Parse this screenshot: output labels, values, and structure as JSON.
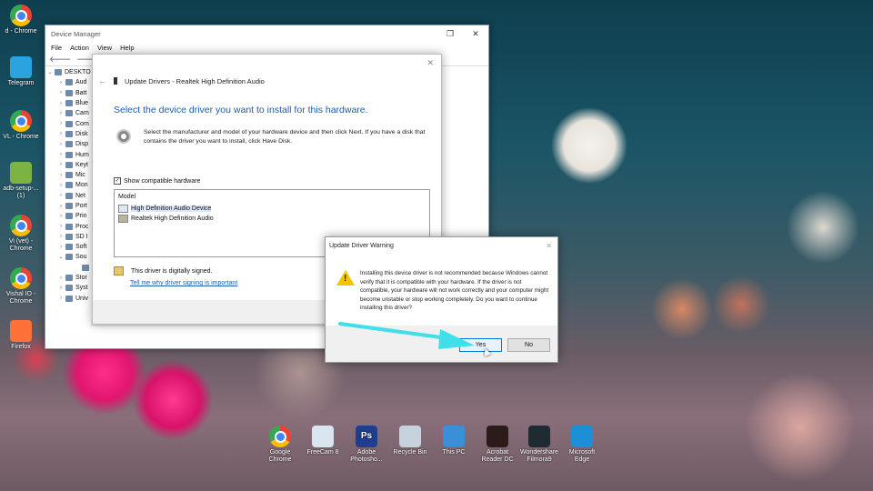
{
  "desktop": {
    "left_icons": [
      {
        "label": "d - Chrome",
        "icon": "chrome-icon"
      },
      {
        "label": "Telegram",
        "icon": "telegram-icon",
        "color": "#2aa3df"
      },
      {
        "label": "VL - Chrome",
        "icon": "chrome-icon"
      },
      {
        "label": "adb-setup-... (1)",
        "icon": "android-icon",
        "color": "#7cb342"
      },
      {
        "label": "Vi (vet) - Chrome",
        "icon": "chrome-icon"
      },
      {
        "label": "Vishal IO - Chrome",
        "icon": "chrome-icon"
      },
      {
        "label": "Firefox",
        "icon": "firefox-icon",
        "color": "#ff7139"
      }
    ],
    "bottom_icons": [
      {
        "label": "Google Chrome",
        "icon": "chrome-icon"
      },
      {
        "label": "FreeCam 8",
        "icon": "freecam-icon",
        "color": "#d9e6f2"
      },
      {
        "label": "Adobe Photosho...",
        "icon": "photoshop-icon",
        "glyph": "Ps",
        "color": "#1f3e8f"
      },
      {
        "label": "Recycle Bin",
        "icon": "recycle-bin-icon",
        "color": "#c6d3de"
      },
      {
        "label": "This PC",
        "icon": "this-pc-icon",
        "color": "#3b8fd9"
      },
      {
        "label": "Acrobat Reader DC",
        "icon": "acrobat-icon",
        "color": "#2b1b1b"
      },
      {
        "label": "Wondershare Filmora9",
        "icon": "filmora-icon",
        "color": "#1f2a33"
      },
      {
        "label": "Microsoft Edge",
        "icon": "edge-icon",
        "color": "#1c8fd6"
      }
    ]
  },
  "device_manager": {
    "title": "Device Manager",
    "menu": [
      "File",
      "Action",
      "View",
      "Help"
    ],
    "tree": [
      {
        "label": "DESKTO",
        "arrow": "⌄"
      },
      {
        "label": "Aud",
        "arrow": "›"
      },
      {
        "label": "Batt",
        "arrow": "›"
      },
      {
        "label": "Blue",
        "arrow": "›"
      },
      {
        "label": "Cam",
        "arrow": "›"
      },
      {
        "label": "Com",
        "arrow": "›"
      },
      {
        "label": "Disk",
        "arrow": "›"
      },
      {
        "label": "Disp",
        "arrow": "›"
      },
      {
        "label": "Hum",
        "arrow": "›"
      },
      {
        "label": "Keyt",
        "arrow": "›"
      },
      {
        "label": "Mic",
        "arrow": "›"
      },
      {
        "label": "Mon",
        "arrow": "›"
      },
      {
        "label": "Net",
        "arrow": "›"
      },
      {
        "label": "Port",
        "arrow": "›"
      },
      {
        "label": "Prin",
        "arrow": "›"
      },
      {
        "label": "Proc",
        "arrow": "›"
      },
      {
        "label": "SD I",
        "arrow": "›"
      },
      {
        "label": "Soft",
        "arrow": "›"
      },
      {
        "label": "Sou",
        "arrow": "⌄"
      },
      {
        "label": "",
        "arrow": ""
      },
      {
        "label": "Stor",
        "arrow": "›"
      },
      {
        "label": "Syst",
        "arrow": "›"
      },
      {
        "label": "Univ",
        "arrow": "›"
      }
    ]
  },
  "update_drivers": {
    "title": "Update Drivers - Realtek High Definition Audio",
    "heading": "Select the device driver you want to install for this hardware.",
    "description": "Select the manufacturer and model of your hardware device and then click Next. If you have a disk that contains the driver you want to install, click Have Disk.",
    "show_compatible": "Show compatible hardware",
    "list_header": "Model",
    "models": [
      "High Definition Audio Device",
      "Realtek High Definition Audio"
    ],
    "signed_text": "This driver is digitally signed.",
    "signing_link": "Tell me why driver signing is important"
  },
  "warning_dialog": {
    "title": "Update Driver Warning",
    "message": "Installing this device driver is not recommended because Windows cannot verify that it is compatible with your hardware. If the driver is not compatible, your hardware will not work correctly and your computer might become unstable or stop working completely. Do you want to continue installing this driver?",
    "yes_label": "Yes",
    "no_label": "No",
    "arrow_color": "#3fe0e8"
  }
}
